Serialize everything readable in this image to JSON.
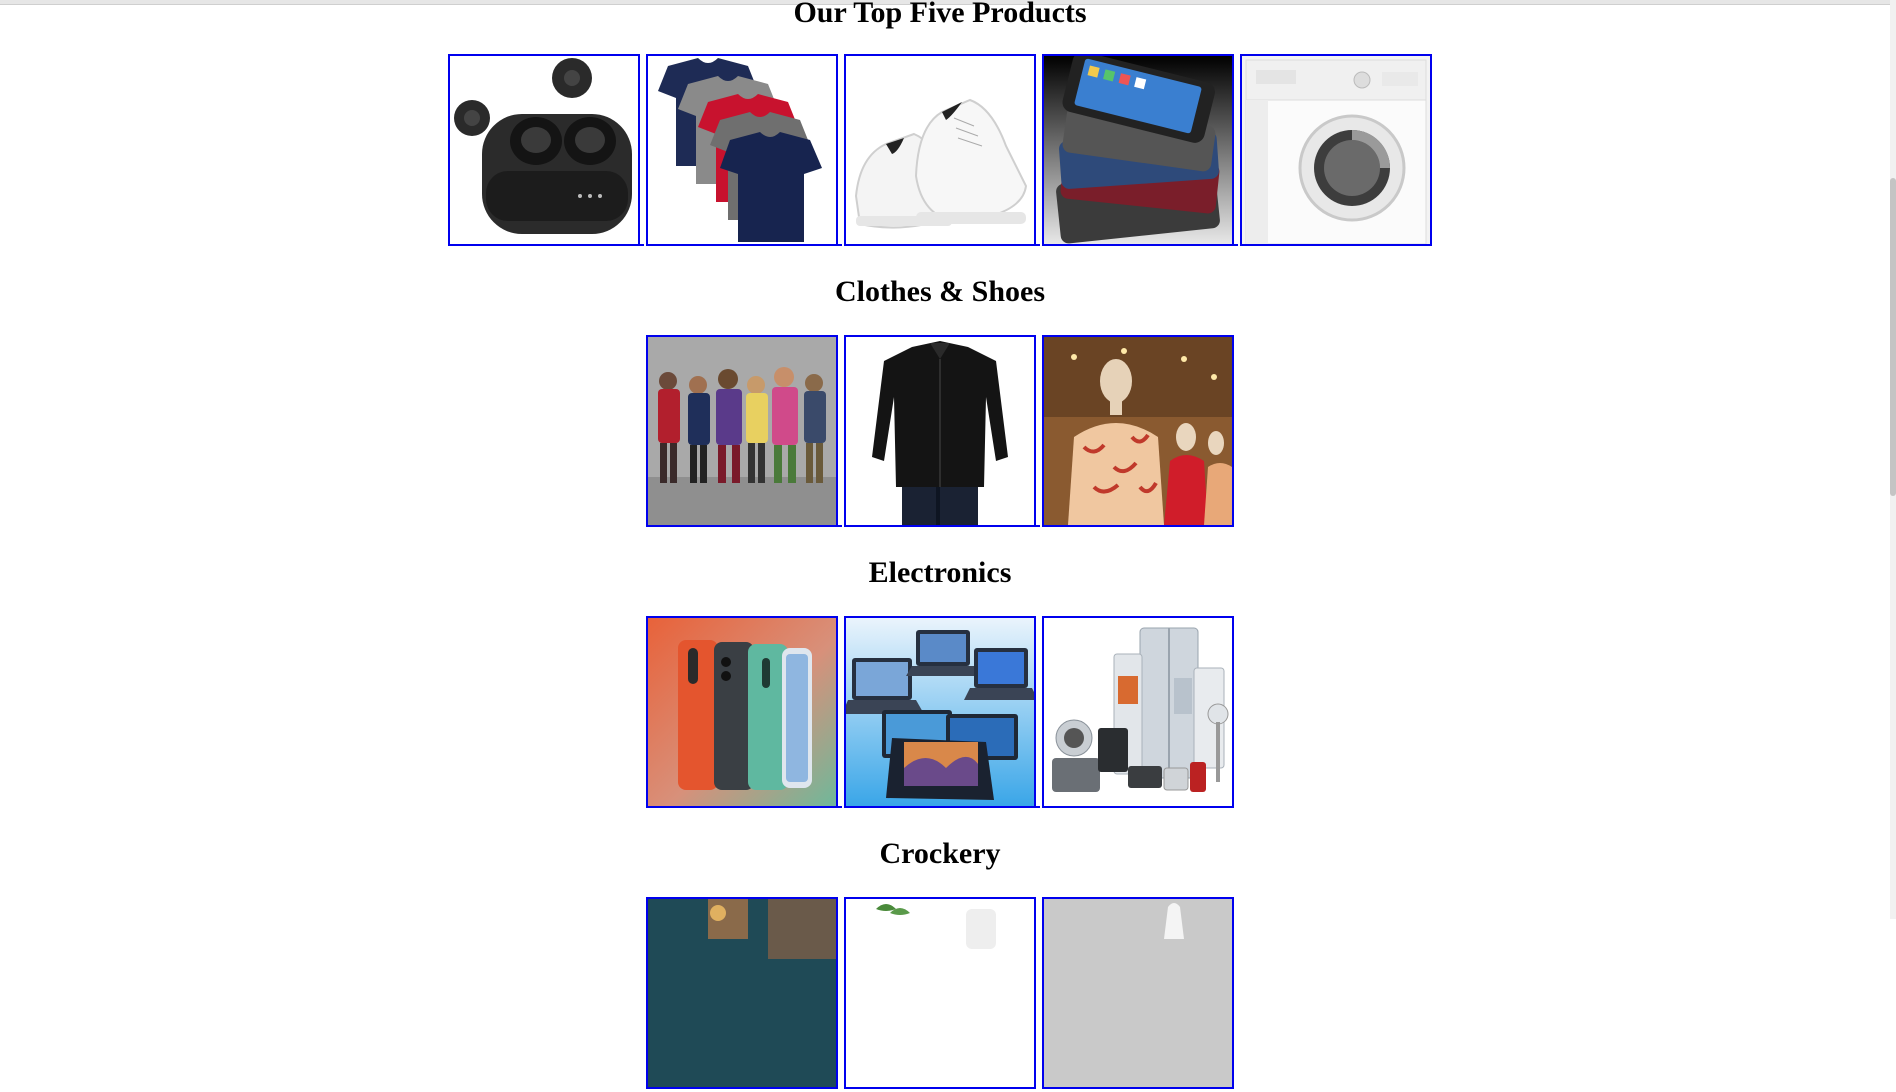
{
  "sections": [
    {
      "title": "Our Top Five Products",
      "items": [
        {
          "icon": "wireless-earbuds-image"
        },
        {
          "icon": "tshirt-stack-image"
        },
        {
          "icon": "white-sneakers-image"
        },
        {
          "icon": "smartphone-stack-image"
        },
        {
          "icon": "washing-machine-image"
        }
      ]
    },
    {
      "title": "Clothes & Shoes",
      "items": [
        {
          "icon": "kids-winter-clothing-image"
        },
        {
          "icon": "black-shirt-image"
        },
        {
          "icon": "mannequins-image"
        }
      ]
    },
    {
      "title": "Electronics",
      "items": [
        {
          "icon": "smartphones-image"
        },
        {
          "icon": "laptops-image"
        },
        {
          "icon": "home-appliances-image"
        }
      ]
    },
    {
      "title": "Crockery",
      "items": [
        {
          "icon": "crockery-image-1"
        },
        {
          "icon": "crockery-image-2"
        },
        {
          "icon": "crockery-image-3"
        }
      ]
    }
  ],
  "colors": {
    "link_border": "#0000ee",
    "background": "#ffffff"
  }
}
